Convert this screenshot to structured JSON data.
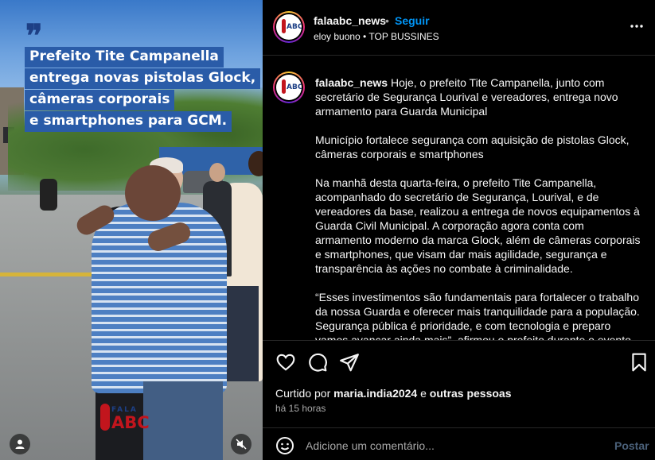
{
  "media": {
    "headline_lines": [
      "Prefeito Tite Campanella",
      "entrega novas pistolas Glock,",
      "câmeras corporais",
      "e smartphones para GCM."
    ],
    "quote_glyph": "❞",
    "brand_top": "FALA",
    "brand_bottom": "ABC",
    "icons": {
      "tags": "user-tag-icon",
      "audio": "muted-speaker-icon"
    }
  },
  "header": {
    "username": "falaabc_news",
    "separator": "•",
    "follow_label": "Seguir",
    "subtitle": "eloy buono • TOP BUSSINES",
    "more_icon": "more-horizontal-icon"
  },
  "caption": {
    "username": "falaabc_news",
    "paragraphs": [
      "Hoje, o prefeito Tite Campanella, junto com secretário de Segurança Lourival e vereadores, entrega novo armamento para Guarda Municipal",
      "Município fortalece segurança com aquisição de pistolas Glock, câmeras corporais e smartphones",
      "Na manhã desta quarta-feira, o prefeito Tite Campanella, acompanhado do secretário de Segurança, Lourival, e de vereadores da base, realizou a entrega de novos equipamentos à Guarda Civil Municipal. A corporação agora conta com armamento moderno da marca Glock, além de câmeras corporais e smartphones, que visam dar mais agilidade, segurança e transparência às ações no combate à criminalidade.",
      "“Esses investimentos são fundamentais para fortalecer o trabalho da nossa Guarda e oferecer mais tranquilidade para a população. Segurança pública é prioridade, e com tecnologia e preparo vamos avançar ainda mais”, afirmou o prefeito durante o evento de"
    ]
  },
  "actions": {
    "icons": [
      "heart-icon",
      "comment-icon",
      "share-icon",
      "save-icon"
    ],
    "liked_prefix": "Curtido por",
    "liked_user": "maria.india2024",
    "liked_connector": "e",
    "liked_others": "outras pessoas",
    "time": "há 15 horas"
  },
  "comment": {
    "placeholder": "Adicione um comentário...",
    "post_label": "Postar"
  },
  "colors": {
    "accent": "#0095f6",
    "headline_bg": "#2a5ca8",
    "background": "#000000"
  }
}
